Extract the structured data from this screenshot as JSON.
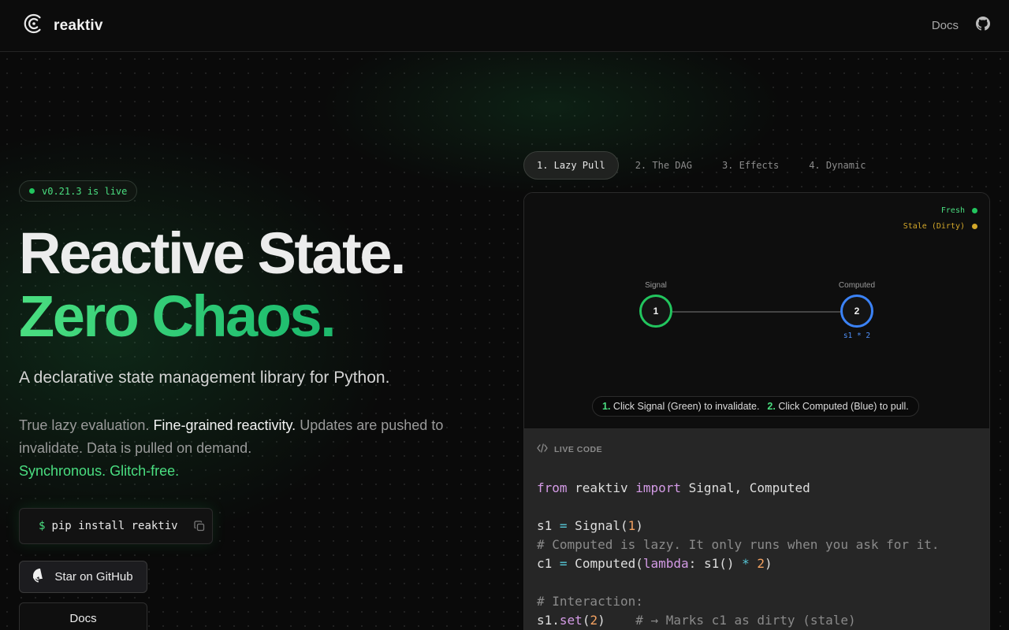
{
  "nav": {
    "brand": "reaktiv",
    "docs_label": "Docs"
  },
  "hero": {
    "badge": "v0.21.3 is live",
    "title_line1": "Reactive State.",
    "title_line2": "Zero Chaos.",
    "subtitle": "A declarative state management library for Python.",
    "desc_part1": "True lazy evaluation.",
    "desc_part2": "Fine-grained reactivity.",
    "desc_part3": "Updates are pushed to invalidate. Data is pulled on demand.",
    "desc_part4": "Synchronous. Glitch-free.",
    "install_prompt": "$",
    "install_cmd": "pip install reaktiv",
    "github_button": "Star on GitHub",
    "docs_button": "Docs"
  },
  "tabs": [
    {
      "label": "1. Lazy Pull",
      "active": true
    },
    {
      "label": "2. The DAG",
      "active": false
    },
    {
      "label": "3. Effects",
      "active": false
    },
    {
      "label": "4. Dynamic",
      "active": false
    }
  ],
  "viz": {
    "legend_fresh": "Fresh",
    "legend_stale": "Stale (Dirty)",
    "signal_label": "Signal",
    "signal_value": "1",
    "computed_label": "Computed",
    "computed_value": "2",
    "computed_formula": "s1 * 2",
    "hint_num1": "1.",
    "hint_text1": "Click Signal (Green) to invalidate.",
    "hint_num2": "2.",
    "hint_text2": "Click Computed (Blue) to pull."
  },
  "code": {
    "header": "LIVE CODE",
    "line1_kw1": "from",
    "line1_mod": " reaktiv ",
    "line1_kw2": "import",
    "line1_rest": " Signal, Computed",
    "line3_var": "s1 ",
    "line3_op": "=",
    "line3_fn": " Signal(",
    "line3_num": "1",
    "line3_end": ")",
    "line4_comment": "# Computed is lazy. It only runs when you ask for it.",
    "line5_var": "c1 ",
    "line5_op": "=",
    "line5_fn": " Computed(",
    "line5_kw": "lambda",
    "line5_mid": ": s1() ",
    "line5_op2": "*",
    "line5_num": " 2",
    "line5_end": ")",
    "line7_comment": "# Interaction:",
    "line8_var": "s1.",
    "line8_fn": "set",
    "line8_open": "(",
    "line8_num": "2",
    "line8_close": ")",
    "line8_comment": "    # → Marks c1 as dirty (stale)"
  },
  "colors": {
    "accent_green": "#22c55e",
    "accent_blue": "#3b82f6",
    "stale_yellow": "#d4a82a"
  },
  "icons": {
    "brand": "reaktiv-logo-icon",
    "github": "github-icon",
    "copy": "copy-icon",
    "code": "code-brackets-icon"
  }
}
